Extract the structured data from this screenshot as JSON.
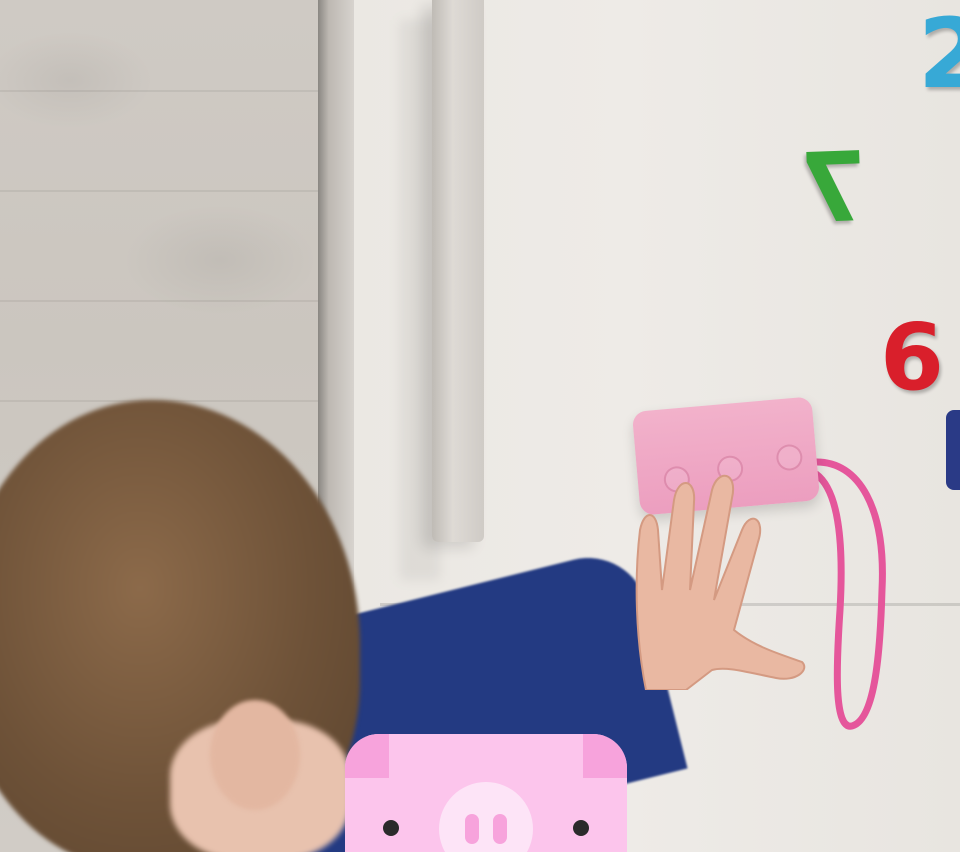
{
  "scene": {
    "description_magnets": [
      "7",
      "6",
      "2"
    ],
    "colors": {
      "wall": "#cfcac4",
      "fridge": "#ebe8e3",
      "device_pink": "#ec9ebf",
      "strap_pink": "#e5569b",
      "sleeve_blue": "#233a82",
      "hair_brown": "#6e5238",
      "pig_pink": "#fcc5ec"
    }
  },
  "magnets": {
    "seven": "7",
    "six": "6",
    "two": "2"
  },
  "icons": {
    "pig": "pig-logo-icon"
  }
}
